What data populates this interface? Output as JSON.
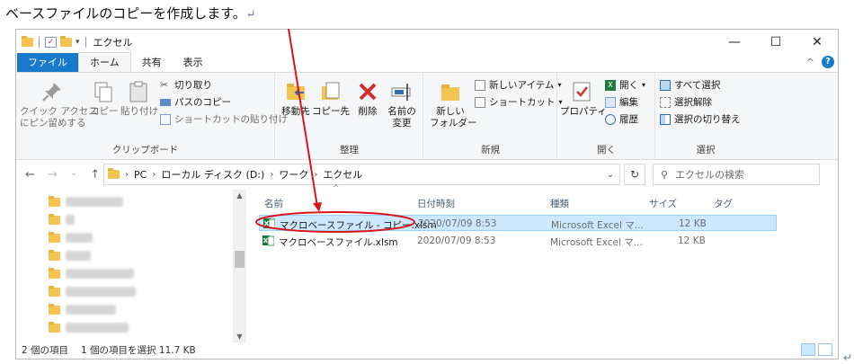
{
  "caption": {
    "text": "ベースファイルのコピーを作成します。",
    "return_mark": "↵"
  },
  "window": {
    "title": "エクセル",
    "controls": {
      "minimize": "—",
      "maximize": "☐",
      "close": "✕"
    }
  },
  "ribbon_tabs": [
    "ファイル",
    "ホーム",
    "共有",
    "表示"
  ],
  "ribbon_right": {
    "collapse": "^",
    "help": "?"
  },
  "ribbon": {
    "clipboard": {
      "label": "クリップボード",
      "pin_line1": "クイック アクセス",
      "pin_line2": "にピン留めする",
      "copy": "コピー",
      "paste": "貼り付け",
      "cut": "切り取り",
      "copy_path": "パスのコピー",
      "paste_shortcut": "ショートカットの貼り付け"
    },
    "organize": {
      "label": "整理",
      "move_to": "移動先",
      "copy_to": "コピー先",
      "delete": "削除",
      "rename_line1": "名前の",
      "rename_line2": "変更"
    },
    "new": {
      "label": "新規",
      "new_folder_line1": "新しい",
      "new_folder_line2": "フォルダー",
      "new_item": "新しいアイテム",
      "shortcut": "ショートカット"
    },
    "open": {
      "label": "開く",
      "properties": "プロパティ",
      "open": "開く",
      "edit": "編集",
      "history": "履歴"
    },
    "select": {
      "label": "選択",
      "select_all": "すべて選択",
      "select_none": "選択解除",
      "invert": "選択の切り替え"
    }
  },
  "address": {
    "back": "←",
    "forward": "→",
    "recent": "⌄",
    "up": "↑",
    "path": [
      "PC",
      "ローカル ディスク (D:)",
      "ワーク",
      "エクセル"
    ],
    "sep": "›",
    "dropdown": "⌄",
    "refresh": "↻",
    "search_placeholder": "エクセルの検索"
  },
  "columns": [
    "名前",
    "日付時刻",
    "種類",
    "サイズ",
    "タグ"
  ],
  "sort_indicator": "^",
  "files": [
    {
      "name": "マクロベースファイル - コピー.xlsm",
      "date": "2020/07/09 8:53",
      "type": "Microsoft Excel マ...",
      "size": "12 KB",
      "selected": true
    },
    {
      "name": "マクロベースファイル.xlsm",
      "date": "2020/07/09 8:53",
      "type": "Microsoft Excel マ...",
      "size": "12 KB",
      "selected": false
    }
  ],
  "status": {
    "item_count": "2 個の項目",
    "selection": "1 個の項目を選択 11.7 KB"
  },
  "colors": {
    "accent": "#1979ca",
    "annotation": "#d9151b",
    "selection": "#cce8ff",
    "folder": "#f3c452"
  },
  "return_mark": "↵"
}
